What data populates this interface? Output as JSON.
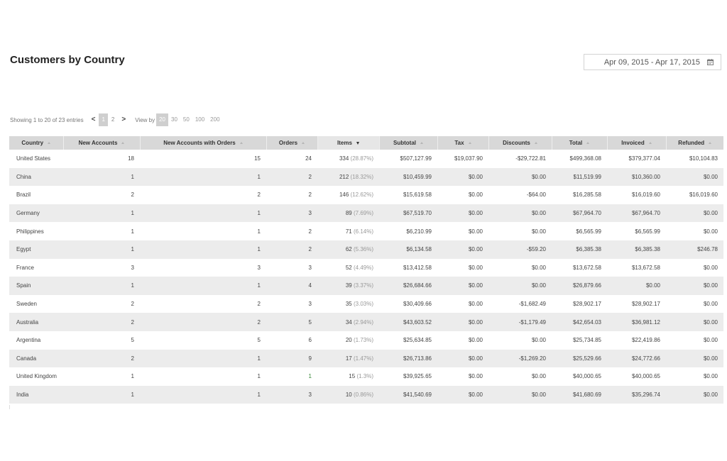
{
  "page": {
    "title": "Customers by Country",
    "date_range": "Apr 09, 2015 - Apr 17, 2015",
    "date_icon": "calendar-icon"
  },
  "toolbar": {
    "entries_text": "Showing 1 to 20 of 23 entries",
    "prev": "<",
    "current_page": "1",
    "next_page": "2",
    "next": ">",
    "view_by_label": "View by",
    "view_by_options": [
      "20",
      "30",
      "50",
      "100",
      "200"
    ]
  },
  "table": {
    "columns": [
      {
        "label": "Country",
        "sort": "asc"
      },
      {
        "label": "New Accounts",
        "sort": "none"
      },
      {
        "label": "New Accounts with Orders",
        "sort": "none"
      },
      {
        "label": "Orders",
        "sort": "none"
      },
      {
        "label": "Items",
        "sort": "desc"
      },
      {
        "label": "Subtotal",
        "sort": "none"
      },
      {
        "label": "Tax",
        "sort": "none"
      },
      {
        "label": "Discounts",
        "sort": "none"
      },
      {
        "label": "Total",
        "sort": "none"
      },
      {
        "label": "Invoiced",
        "sort": "none"
      },
      {
        "label": "Refunded",
        "sort": "none"
      }
    ],
    "rows": [
      {
        "country": "United States",
        "new_accounts": "18",
        "new_with_orders": "15",
        "orders": "24",
        "items": "334",
        "items_pct": "(28.87%)",
        "subtotal": "$507,127.99",
        "tax": "$19,037.90",
        "discounts": "-$29,722.81",
        "total": "$499,368.08",
        "invoiced": "$379,377.04",
        "refunded": "$10,104.83"
      },
      {
        "country": "China",
        "new_accounts": "1",
        "new_with_orders": "1",
        "orders": "2",
        "items": "212",
        "items_pct": "(18.32%)",
        "subtotal": "$10,459.99",
        "tax": "$0.00",
        "discounts": "$0.00",
        "total": "$11,519.99",
        "invoiced": "$10,360.00",
        "refunded": "$0.00"
      },
      {
        "country": "Brazil",
        "new_accounts": "2",
        "new_with_orders": "2",
        "orders": "2",
        "items": "146",
        "items_pct": "(12.62%)",
        "subtotal": "$15,619.58",
        "tax": "$0.00",
        "discounts": "-$64.00",
        "total": "$16,285.58",
        "invoiced": "$16,019.60",
        "refunded": "$16,019.60"
      },
      {
        "country": "Germany",
        "new_accounts": "1",
        "new_with_orders": "1",
        "orders": "3",
        "items": "89",
        "items_pct": "(7.69%)",
        "subtotal": "$67,519.70",
        "tax": "$0.00",
        "discounts": "$0.00",
        "total": "$67,964.70",
        "invoiced": "$67,964.70",
        "refunded": "$0.00"
      },
      {
        "country": "Philippines",
        "new_accounts": "1",
        "new_with_orders": "1",
        "orders": "2",
        "items": "71",
        "items_pct": "(6.14%)",
        "subtotal": "$6,210.99",
        "tax": "$0.00",
        "discounts": "$0.00",
        "total": "$6,565.99",
        "invoiced": "$6,565.99",
        "refunded": "$0.00"
      },
      {
        "country": "Egypt",
        "new_accounts": "1",
        "new_with_orders": "1",
        "orders": "2",
        "items": "62",
        "items_pct": "(5.36%)",
        "subtotal": "$6,134.58",
        "tax": "$0.00",
        "discounts": "-$59.20",
        "total": "$6,385.38",
        "invoiced": "$6,385.38",
        "refunded": "$246.78"
      },
      {
        "country": "France",
        "new_accounts": "3",
        "new_with_orders": "3",
        "orders": "3",
        "items": "52",
        "items_pct": "(4.49%)",
        "subtotal": "$13,412.58",
        "tax": "$0.00",
        "discounts": "$0.00",
        "total": "$13,672.58",
        "invoiced": "$13,672.58",
        "refunded": "$0.00"
      },
      {
        "country": "Spain",
        "new_accounts": "1",
        "new_with_orders": "1",
        "orders": "4",
        "items": "39",
        "items_pct": "(3.37%)",
        "subtotal": "$26,684.66",
        "tax": "$0.00",
        "discounts": "$0.00",
        "total": "$26,879.66",
        "invoiced": "$0.00",
        "refunded": "$0.00"
      },
      {
        "country": "Sweden",
        "new_accounts": "2",
        "new_with_orders": "2",
        "orders": "3",
        "items": "35",
        "items_pct": "(3.03%)",
        "subtotal": "$30,409.66",
        "tax": "$0.00",
        "discounts": "-$1,682.49",
        "total": "$28,902.17",
        "invoiced": "$28,902.17",
        "refunded": "$0.00"
      },
      {
        "country": "Australia",
        "new_accounts": "2",
        "new_with_orders": "2",
        "orders": "5",
        "items": "34",
        "items_pct": "(2.94%)",
        "subtotal": "$43,603.52",
        "tax": "$0.00",
        "discounts": "-$1,179.49",
        "total": "$42,654.03",
        "invoiced": "$36,981.12",
        "refunded": "$0.00"
      },
      {
        "country": "Argentina",
        "new_accounts": "5",
        "new_with_orders": "5",
        "orders": "6",
        "items": "20",
        "items_pct": "(1.73%)",
        "subtotal": "$25,634.85",
        "tax": "$0.00",
        "discounts": "$0.00",
        "total": "$25,734.85",
        "invoiced": "$22,419.86",
        "refunded": "$0.00"
      },
      {
        "country": "Canada",
        "new_accounts": "2",
        "new_with_orders": "1",
        "orders": "9",
        "items": "17",
        "items_pct": "(1.47%)",
        "subtotal": "$26,713.86",
        "tax": "$0.00",
        "discounts": "-$1,269.20",
        "total": "$25,529.66",
        "invoiced": "$24,772.66",
        "refunded": "$0.00"
      },
      {
        "country": "United Kingdom",
        "new_accounts": "1",
        "new_with_orders": "1",
        "orders": "1",
        "items": "15",
        "items_pct": "(1.3%)",
        "subtotal": "$39,925.65",
        "tax": "$0.00",
        "discounts": "$0.00",
        "total": "$40,000.65",
        "invoiced": "$40,000.65",
        "refunded": "$0.00",
        "orders_highlight": "#3a8a3a"
      },
      {
        "country": "India",
        "new_accounts": "1",
        "new_with_orders": "1",
        "orders": "3",
        "items": "10",
        "items_pct": "(0.86%)",
        "subtotal": "$41,540.69",
        "tax": "$0.00",
        "discounts": "$0.00",
        "total": "$41,680.69",
        "invoiced": "$35,296.74",
        "refunded": "$0.00"
      }
    ]
  },
  "colors": {
    "header_bg": "#d8d8d8",
    "stripe_bg": "#ececec",
    "active_chip": "#cfcfcf"
  }
}
